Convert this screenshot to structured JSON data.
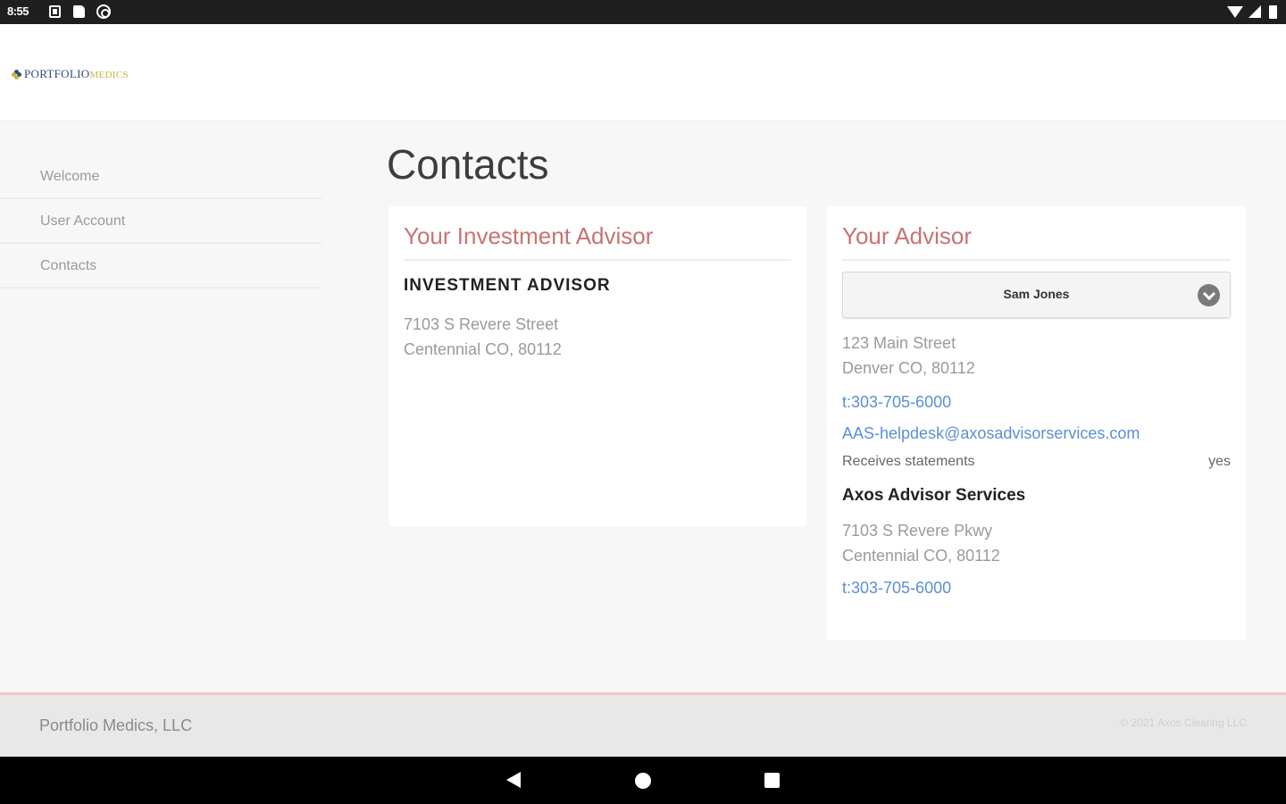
{
  "status_bar": {
    "time": "8:55"
  },
  "header": {
    "logo_text_primary": "PORTFOLIO",
    "logo_text_secondary": "MEDICS"
  },
  "sidebar": {
    "items": [
      {
        "label": "Welcome"
      },
      {
        "label": "User Account"
      },
      {
        "label": "Contacts"
      }
    ]
  },
  "main": {
    "title": "Contacts",
    "investment_advisor_card": {
      "title": "Your Investment Advisor",
      "name": "INVESTMENT ADVISOR",
      "address_line1": "7103 S Revere Street",
      "address_line2": "Centennial CO, 80112"
    },
    "advisor_card": {
      "title": "Your Advisor",
      "selected_advisor": "Sam Jones",
      "address_line1": "123 Main Street",
      "address_line2": "Denver CO, 80112",
      "phone": "t:303-705-6000",
      "email": "AAS-helpdesk@axosadvisorservices.com",
      "statements_label": "Receives statements",
      "statements_value": "yes",
      "company_name": "Axos Advisor Services",
      "company_address_line1": "7103 S Revere Pkwy",
      "company_address_line2": "Centennial CO, 80112",
      "company_phone": "t:303-705-6000"
    }
  },
  "footer": {
    "company": "Portfolio Medics, LLC",
    "copyright": "© 2021 Axos Clearing LLC"
  },
  "colors": {
    "accent": "#c97272",
    "link": "#5b8fd6",
    "logo_primary": "#2f4b7c",
    "logo_secondary": "#c4b63a"
  }
}
